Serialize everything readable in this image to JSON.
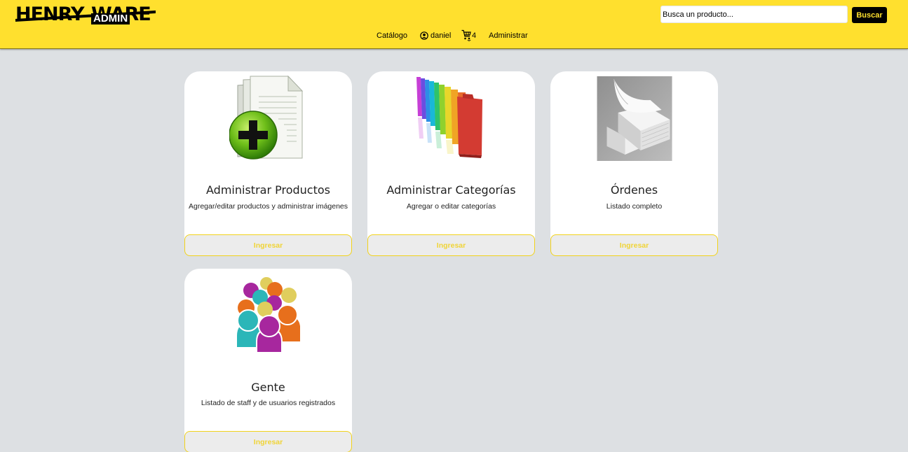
{
  "header": {
    "logo": {
      "word1": "HENRY",
      "word2": "WARE",
      "badge": "ADMIN"
    },
    "search": {
      "placeholder": "Busca un producto...",
      "button_label": "Buscar"
    },
    "nav": {
      "catalog_label": "Catálogo",
      "user_label": "daniel",
      "cart_count": "4",
      "admin_label": "Administrar"
    }
  },
  "cards": [
    {
      "title": "Administrar Productos",
      "description": "Agregar/editar productos y administrar imágenes",
      "button_label": "Ingresar",
      "icon": "add-document-icon"
    },
    {
      "title": "Administrar Categorías",
      "description": "Agregar o editar categorías",
      "button_label": "Ingresar",
      "icon": "rainbow-folders-icon"
    },
    {
      "title": "Órdenes",
      "description": "Listado completo",
      "button_label": "Ingresar",
      "icon": "paper-stack-icon"
    },
    {
      "title": "Gente",
      "description": "Listado de staff y de usuarios registrados",
      "button_label": "Ingresar",
      "icon": "people-group-icon"
    }
  ],
  "colors": {
    "header_bg": "#ffe02e",
    "page_bg": "#dde0e3",
    "button_text": "#f0d437",
    "button_border": "#f1d21b",
    "search_button_bg": "#000000"
  }
}
